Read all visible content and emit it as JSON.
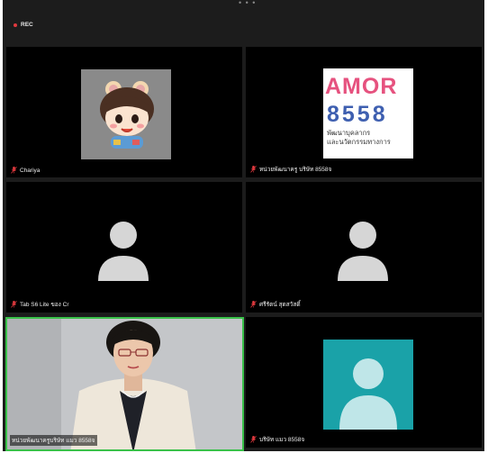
{
  "app": {
    "grip_glyph": "• • •"
  },
  "recording": {
    "label": "REC",
    "color": "#e0393e"
  },
  "participants": [
    {
      "name": "Chariya",
      "avatar": "cartoon-avatar",
      "muted": true
    },
    {
      "name": "หน่วยพัฒนาครู บริษัท 8558จ",
      "avatar": "amor-logo",
      "muted": true
    },
    {
      "name": "Tab S6 Lite ของ Cr",
      "avatar": "default-person-icon",
      "muted": true
    },
    {
      "name": "ศรีรัตน์ สุดสวัสดิ์",
      "avatar": "default-person-icon",
      "muted": true
    },
    {
      "name": "หน่วยพัฒนาครูบริษัท แมว 8558จ",
      "avatar": "camera-video",
      "muted": true,
      "active_speaker": true
    },
    {
      "name": "บริษัท แมว 8558จ",
      "avatar": "default-person-icon",
      "muted": true
    }
  ],
  "amor_logo": {
    "line1": "AMOR",
    "line2": "8558",
    "line3": "พัฒนาบุคลากร",
    "line4": "และนวัตกรรมทางการ"
  },
  "colors": {
    "active_border": "#3ac14a",
    "mic_muted": "#e0393e",
    "teal_avatar": "#1aa2a8"
  }
}
